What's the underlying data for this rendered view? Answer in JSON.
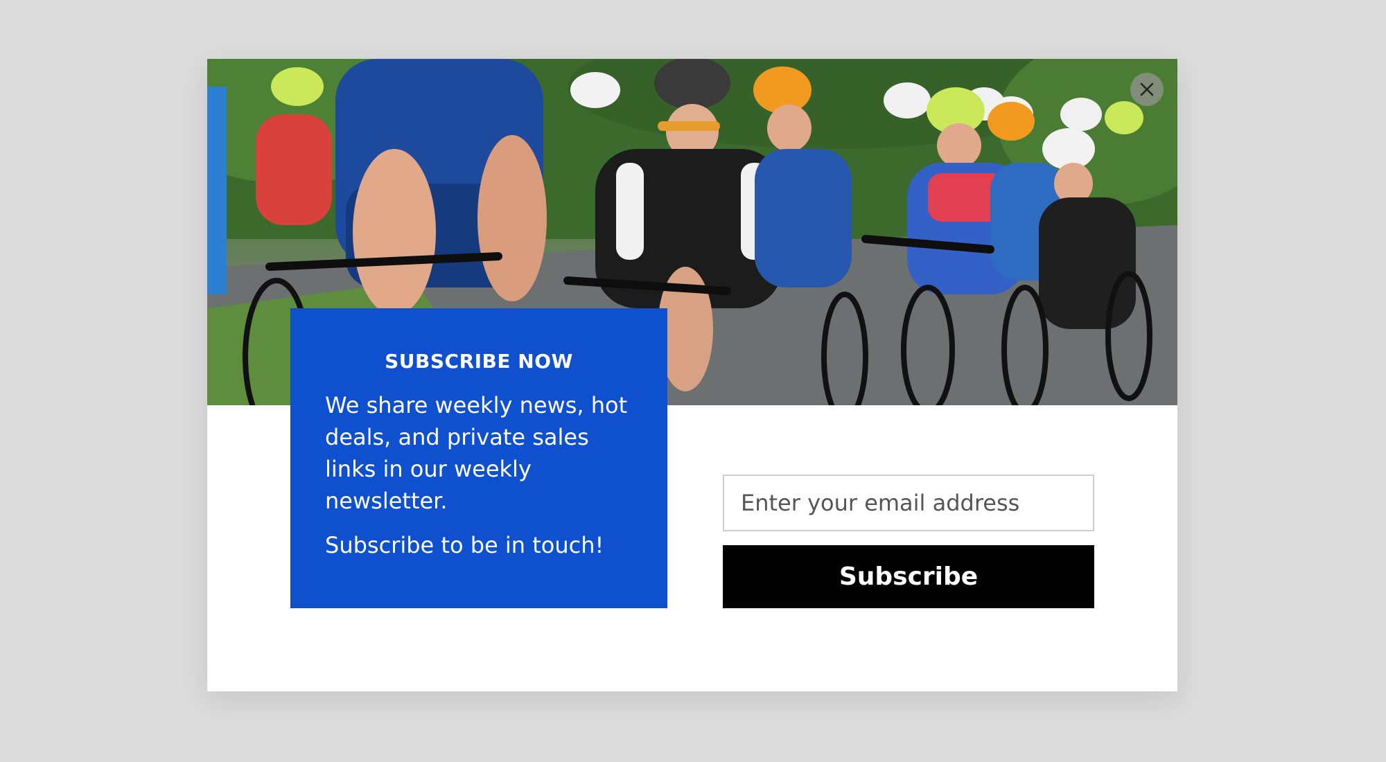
{
  "popup": {
    "title": "SUBSCRIBE NOW",
    "description": "We share weekly news, hot deals, and private sales links in our weekly newsletter.",
    "cta_text": "Subscribe to be in touch!",
    "email_placeholder": "Enter your email address",
    "subscribe_label": "Subscribe",
    "close_icon": "close-icon",
    "hero_image": "cyclists-peloton-photo"
  },
  "colors": {
    "page_background": "#dcdcdc",
    "promo_panel": "#0f50cf",
    "button_background": "#000000",
    "button_text": "#ffffff"
  }
}
